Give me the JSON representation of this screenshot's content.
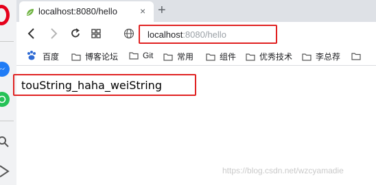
{
  "sidebar": {
    "icons": [
      "opera-logo",
      "messenger-icon",
      "whatsapp-icon",
      "search-icon",
      "send-icon"
    ]
  },
  "tab": {
    "title": "localhost:8080/hello",
    "favicon": "leaf-icon",
    "close_label": "×"
  },
  "newtab_label": "+",
  "toolbar": {
    "icons": [
      "back-icon",
      "forward-icon",
      "reload-icon",
      "grid-icon",
      "globe-icon"
    ]
  },
  "address": {
    "host": "localhost",
    "rest": ":8080/hello"
  },
  "bookmarks": [
    {
      "label": "百度"
    },
    {
      "label": "博客论坛"
    },
    {
      "label": "Git"
    },
    {
      "label": "常用"
    },
    {
      "label": "组件"
    },
    {
      "label": "优秀技术"
    },
    {
      "label": "李总荐"
    }
  ],
  "page": {
    "output": "touString_haha_weiString",
    "watermark": "https://blog.csdn.net/wzcyamadie"
  },
  "colors": {
    "highlight_red": "#e02020",
    "opera_red": "#e5001b",
    "tabstrip": "#dee1e6",
    "sidebar": "#f1f2f4"
  }
}
